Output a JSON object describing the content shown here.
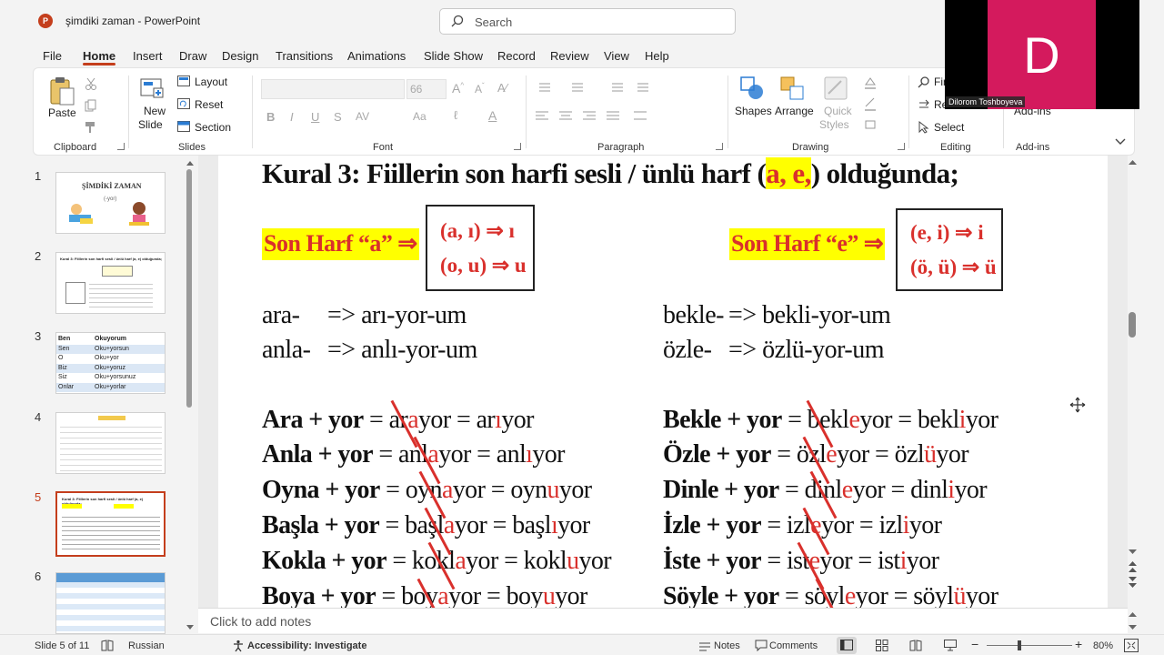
{
  "window": {
    "title": "şimdiki zaman  -  PowerPoint",
    "app_icon": "P"
  },
  "search": {
    "placeholder": "Search"
  },
  "menu": {
    "tabs": [
      "File",
      "Home",
      "Insert",
      "Draw",
      "Design",
      "Transitions",
      "Animations",
      "Slide Show",
      "Record",
      "Review",
      "View",
      "Help"
    ],
    "active": "Home"
  },
  "ribbon": {
    "clipboard": {
      "paste": "Paste",
      "label": "Clipboard"
    },
    "slides": {
      "new_slide_1": "New",
      "new_slide_2": "Slide",
      "layout": "Layout",
      "reset": "Reset",
      "section": "Section",
      "label": "Slides"
    },
    "font": {
      "font_size": "66",
      "label": "Font"
    },
    "paragraph": {
      "label": "Paragraph"
    },
    "drawing": {
      "shapes": "Shapes",
      "arrange": "Arrange",
      "quick_styles_1": "Quick",
      "quick_styles_2": "Styles",
      "label": "Drawing"
    },
    "editing": {
      "find": "Find",
      "replace": "Re",
      "select": "Select",
      "label": "Editing"
    },
    "addins": {
      "addins": "Add-ins",
      "label": "Add-ins"
    }
  },
  "video": {
    "initial": "D",
    "name": "Dilorom Toshboyeva",
    "color": "#d41a5d"
  },
  "thumbnails": [
    {
      "num": "1",
      "title": "ŞİMDİKİ ZAMAN",
      "sub": "(-yor)"
    },
    {
      "num": "2",
      "title": "Kural 3: Fiillerin son harfi sesli / ünlü harf (a, e) olduğunda;"
    },
    {
      "num": "3",
      "rows": [
        [
          "Ben",
          "Okuyorum"
        ],
        [
          "Sen",
          "Oku+yorsun"
        ],
        [
          "O",
          "Oku+yor"
        ],
        [
          "Biz",
          "Oku+yoruz"
        ],
        [
          "Siz",
          "Oku+yorsunuz"
        ],
        [
          "Onlar",
          "Oku+yorlar"
        ]
      ]
    },
    {
      "num": "4"
    },
    {
      "num": "5",
      "title": "Kural 3: Fiillerin son harfi sesli / ünlü harf (a, e) olduğunda;"
    },
    {
      "num": "6"
    }
  ],
  "slide": {
    "heading_pre": "Kural 3: Fiillerin son harfi sesli / ünlü harf (",
    "heading_hl": "a, e,",
    "heading_post": ") olduğunda;",
    "left_label": "Son Harf “a” ⇒",
    "left_rule_1": "(a, ı) ⇒ ı",
    "left_rule_2": "(o, u) ⇒ u",
    "right_label": "Son Harf “e” ⇒",
    "right_rule_1": "(e, i) ⇒ i",
    "right_rule_2": "(ö, ü) ⇒ ü",
    "left_examples": [
      {
        "stem": "ara-",
        "result": "=> arı-yor-um"
      },
      {
        "stem": "anla-",
        "result": "=> anlı-yor-um"
      }
    ],
    "right_examples": [
      {
        "stem": "bekle-",
        "result": "=> bekli-yor-um"
      },
      {
        "stem": "özle-",
        "result": "=> özlü-yor-um"
      }
    ],
    "left_equations": [
      {
        "verb": "Ara + yor",
        "mid_a": "ar",
        "mid_b": "a",
        "mid_c": "yor",
        "res_a": "ar",
        "res_b": "ı",
        "res_c": "yor"
      },
      {
        "verb": "Anla + yor",
        "mid_a": "anl",
        "mid_b": "a",
        "mid_c": "yor",
        "res_a": "anl",
        "res_b": "ı",
        "res_c": "yor"
      },
      {
        "verb": "Oyna + yor",
        "mid_a": "oyn",
        "mid_b": "a",
        "mid_c": "yor",
        "res_a": "oyn",
        "res_b": "u",
        "res_c": "yor"
      },
      {
        "verb": "Başla + yor",
        "mid_a": "başl",
        "mid_b": "a",
        "mid_c": "yor",
        "res_a": "başl",
        "res_b": "ı",
        "res_c": "yor"
      },
      {
        "verb": "Kokla + yor",
        "mid_a": "kokl",
        "mid_b": "a",
        "mid_c": "yor",
        "res_a": "kokl",
        "res_b": "u",
        "res_c": "yor"
      },
      {
        "verb": "Boya + yor",
        "mid_a": "boy",
        "mid_b": "a",
        "mid_c": "yor",
        "res_a": "boy",
        "res_b": "u",
        "res_c": "yor"
      }
    ],
    "right_equations": [
      {
        "verb": "Bekle + yor",
        "mid_a": "bekl",
        "mid_b": "e",
        "mid_c": "yor",
        "res_a": "bekl",
        "res_b": "i",
        "res_c": "yor"
      },
      {
        "verb": "Özle + yor",
        "mid_a": "özl",
        "mid_b": "e",
        "mid_c": "yor",
        "res_a": "özl",
        "res_b": "ü",
        "res_c": "yor"
      },
      {
        "verb": "Dinle + yor",
        "mid_a": "dinl",
        "mid_b": "e",
        "mid_c": "yor",
        "res_a": "dinl",
        "res_b": "i",
        "res_c": "yor"
      },
      {
        "verb": "İzle + yor",
        "mid_a": "izl",
        "mid_b": "e",
        "mid_c": "yor",
        "res_a": "izl",
        "res_b": "i",
        "res_c": "yor"
      },
      {
        "verb": "İste + yor",
        "mid_a": "ist",
        "mid_b": "e",
        "mid_c": "yor",
        "res_a": "ist",
        "res_b": "i",
        "res_c": "yor"
      },
      {
        "verb": "Söyle + yor",
        "mid_a": "söyl",
        "mid_b": "e",
        "mid_c": "yor",
        "res_a": "söyl",
        "res_b": "ü",
        "res_c": "yor"
      }
    ]
  },
  "notes": {
    "placeholder": "Click to add notes"
  },
  "status": {
    "slide_info": "Slide 5 of 11",
    "language": "Russian",
    "accessibility": "Accessibility: Investigate",
    "notes": "Notes",
    "comments": "Comments",
    "zoom": "80%"
  },
  "colors": {
    "accent": "#c43e1c",
    "highlight": "#ffff00",
    "rule_red": "#d9302c"
  }
}
